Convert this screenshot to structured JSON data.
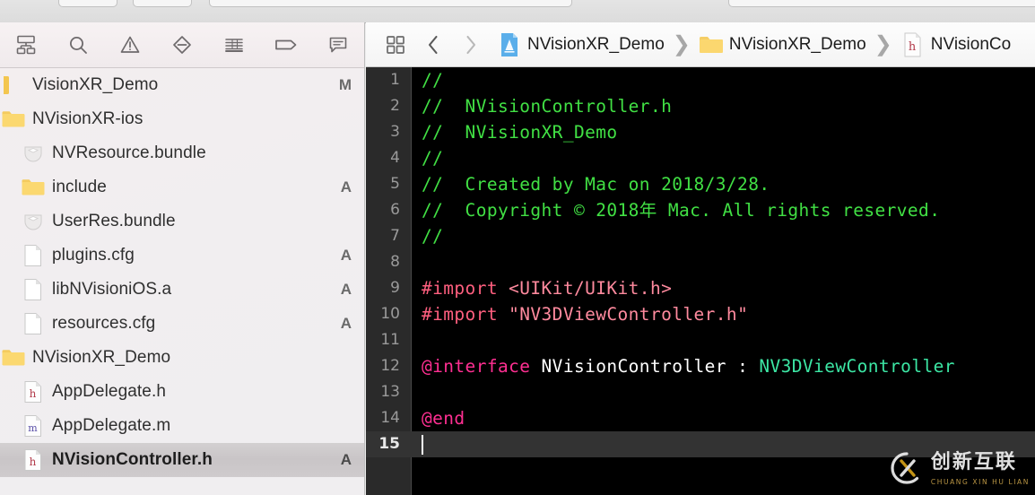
{
  "window": {
    "bg_color": "#ececec"
  },
  "navigator": {
    "toolbar": [
      {
        "name": "project-navigator-icon",
        "label": "Project navigator"
      },
      {
        "name": "search-navigator-icon",
        "label": "Find navigator"
      },
      {
        "name": "issue-navigator-icon",
        "label": "Issue navigator"
      },
      {
        "name": "test-navigator-icon",
        "label": "Test navigator"
      },
      {
        "name": "debug-navigator-icon",
        "label": "Debug navigator"
      },
      {
        "name": "breakpoint-navigator-icon",
        "label": "Breakpoint navigator"
      },
      {
        "name": "report-navigator-icon",
        "label": "Report navigator"
      }
    ],
    "items": [
      {
        "label": "VisionXR_Demo",
        "icon": "project-icon",
        "indent": 0,
        "status": "M",
        "selected": false
      },
      {
        "label": "NVisionXR-ios",
        "icon": "folder-icon",
        "indent": 0,
        "status": "",
        "selected": false
      },
      {
        "label": "NVResource.bundle",
        "icon": "bundle-icon",
        "indent": 1,
        "status": "",
        "selected": false
      },
      {
        "label": "include",
        "icon": "folder-icon",
        "indent": 1,
        "status": "A",
        "selected": false
      },
      {
        "label": "UserRes.bundle",
        "icon": "bundle-icon",
        "indent": 1,
        "status": "",
        "selected": false
      },
      {
        "label": "plugins.cfg",
        "icon": "file-icon",
        "indent": 1,
        "status": "A",
        "selected": false
      },
      {
        "label": "libNVisioniOS.a",
        "icon": "file-icon",
        "indent": 1,
        "status": "A",
        "selected": false
      },
      {
        "label": "resources.cfg",
        "icon": "file-icon",
        "indent": 1,
        "status": "A",
        "selected": false
      },
      {
        "label": "NVisionXR_Demo",
        "icon": "folder-icon",
        "indent": 0,
        "status": "",
        "selected": false
      },
      {
        "label": "AppDelegate.h",
        "icon": "header-icon",
        "indent": 1,
        "status": "",
        "selected": false
      },
      {
        "label": "AppDelegate.m",
        "icon": "source-icon",
        "indent": 1,
        "status": "",
        "selected": false
      },
      {
        "label": "NVisionController.h",
        "icon": "header-icon",
        "indent": 1,
        "status": "A",
        "selected": true
      }
    ]
  },
  "jump_bar": {
    "related_items_icon": "related-items-icon",
    "back_label": "Back",
    "forward_label": "Forward",
    "breadcrumbs": [
      {
        "label": "NVisionXR_Demo",
        "icon": "xcode-project-icon"
      },
      {
        "label": "NVisionXR_Demo",
        "icon": "folder-icon"
      },
      {
        "label": "NVisionCo",
        "icon": "header-icon"
      }
    ]
  },
  "editor": {
    "colors": {
      "background": "#000000",
      "gutter": "#2a2a2a",
      "current_line": "#333333",
      "comment": "#41e044",
      "preprocessor": "#ff5f7f",
      "string": "#ff8a9e",
      "keyword": "#ff2f92",
      "plain": "#ffffff",
      "type": "#3ce6a4"
    },
    "lines": [
      {
        "num": "1",
        "tokens": [
          {
            "t": "//",
            "c": "comment"
          }
        ]
      },
      {
        "num": "2",
        "tokens": [
          {
            "t": "//  NVisionController.h",
            "c": "comment"
          }
        ]
      },
      {
        "num": "3",
        "tokens": [
          {
            "t": "//  NVisionXR_Demo",
            "c": "comment"
          }
        ]
      },
      {
        "num": "4",
        "tokens": [
          {
            "t": "//",
            "c": "comment"
          }
        ]
      },
      {
        "num": "5",
        "tokens": [
          {
            "t": "//  Created by Mac on 2018/3/28.",
            "c": "comment"
          }
        ]
      },
      {
        "num": "6",
        "tokens": [
          {
            "t": "//  Copyright © 2018年 Mac. All rights reserved.",
            "c": "comment"
          }
        ]
      },
      {
        "num": "7",
        "tokens": [
          {
            "t": "//",
            "c": "comment"
          }
        ]
      },
      {
        "num": "8",
        "tokens": []
      },
      {
        "num": "9",
        "tokens": [
          {
            "t": "#import ",
            "c": "pre"
          },
          {
            "t": "<UIKit/UIKit.h>",
            "c": "str"
          }
        ]
      },
      {
        "num": "10",
        "tokens": [
          {
            "t": "#import ",
            "c": "pre"
          },
          {
            "t": "\"NV3DViewController.h\"",
            "c": "str"
          }
        ]
      },
      {
        "num": "11",
        "tokens": []
      },
      {
        "num": "12",
        "tokens": [
          {
            "t": "@interface",
            "c": "kw"
          },
          {
            "t": " NVisionController : ",
            "c": "plain"
          },
          {
            "t": "NV3DViewController",
            "c": "type"
          }
        ]
      },
      {
        "num": "13",
        "tokens": []
      },
      {
        "num": "14",
        "tokens": [
          {
            "t": "@end",
            "c": "kw"
          }
        ]
      },
      {
        "num": "15",
        "tokens": [],
        "current": true
      }
    ]
  },
  "watermark": {
    "chinese": "创新互联",
    "pinyin": "CHUANG XIN HU LIAN",
    "gold": "#d4a017"
  }
}
